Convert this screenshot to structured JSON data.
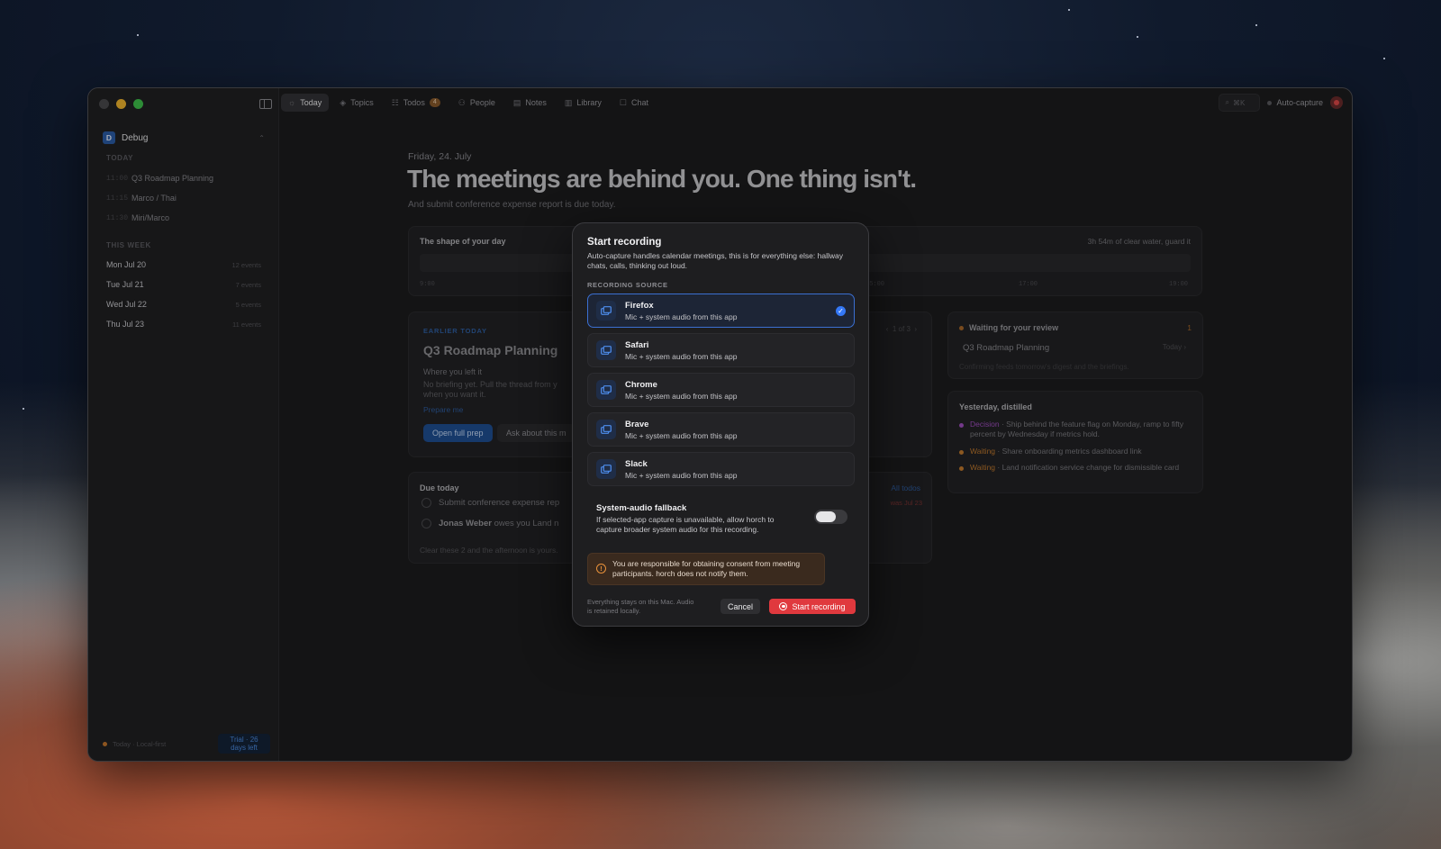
{
  "toolbar": {
    "tabs": [
      {
        "label": "Today",
        "icon": "sun-icon"
      },
      {
        "label": "Topics",
        "icon": "layers-icon"
      },
      {
        "label": "Todos",
        "icon": "checklist-icon",
        "count": "4"
      },
      {
        "label": "People",
        "icon": "people-icon"
      },
      {
        "label": "Notes",
        "icon": "notes-icon"
      },
      {
        "label": "Library",
        "icon": "library-icon"
      },
      {
        "label": "Chat",
        "icon": "chat-icon"
      }
    ],
    "search_shortcut": "⌘K",
    "auto_capture_label": "Auto-capture"
  },
  "sidebar": {
    "workspace": {
      "initial": "D",
      "name": "Debug"
    },
    "today_heading": "TODAY",
    "today_items": [
      {
        "time": "11:00",
        "label": "Q3 Roadmap Planning"
      },
      {
        "time": "11:15",
        "label": "Marco / Thai"
      },
      {
        "time": "11:30",
        "label": "Miri/Marco"
      }
    ],
    "week_heading": "THIS WEEK",
    "week_items": [
      {
        "label": "Mon Jul 20",
        "count": "12 events"
      },
      {
        "label": "Tue Jul 21",
        "count": "7 events"
      },
      {
        "label": "Wed Jul 22",
        "count": "5 events"
      },
      {
        "label": "Thu Jul 23",
        "count": "11 events"
      }
    ],
    "footer_status": "Today · Local-first",
    "trial": "Trial · 26 days left"
  },
  "main": {
    "date": "Friday, 24. July",
    "headline": "The meetings are behind you. One thing isn't.",
    "subline": "And submit conference expense report is due today.",
    "day_shape": {
      "title": "The shape of your day",
      "right": "3h 54m of clear water, guard it",
      "ticks": [
        "9:00",
        "15:00",
        "17:00",
        "19:00"
      ]
    },
    "earlier": {
      "eyebrow": "EARLIER TODAY",
      "title": "Q3 Roadmap Planning",
      "label": "Where you left it",
      "text": "No briefing yet. Pull the thread from y when you want it.",
      "link": "Prepare me",
      "primary_button": "Open full prep",
      "secondary_button": "Ask about this m",
      "pager": "1 of 3"
    },
    "due": {
      "title": "Due today",
      "all_link": "All todos",
      "rows": [
        {
          "prefix": "",
          "text": "Submit conference expense rep",
          "late": "was Jul 23"
        },
        {
          "prefix": "Jonas Weber",
          "text": " owes you Land n",
          "late": ""
        }
      ],
      "footer": "Clear these 2 and the afternoon is yours."
    },
    "review": {
      "title": "Waiting for your review",
      "count": "1",
      "item": "Q3 Roadmap Planning",
      "item_time": "Today",
      "footer": "Confirming feeds tomorrow's digest and the briefings."
    },
    "distilled": {
      "title": "Yesterday, distilled",
      "rows": [
        {
          "kind": "Decision",
          "color": "#a04fbf",
          "text": " · Ship behind the feature flag on Monday, ramp to fifty percent by Wednesday if metrics hold."
        },
        {
          "kind": "Waiting",
          "color": "#c27a2e",
          "text": " · Share onboarding metrics dashboard link"
        },
        {
          "kind": "Waiting",
          "color": "#c27a2e",
          "text": " · Land notification service change for dismissible card"
        }
      ]
    }
  },
  "modal": {
    "title": "Start recording",
    "description": "Auto-capture handles calendar meetings, this is for everything else: hallway chats, calls, thinking out loud.",
    "section_label": "RECORDING SOURCE",
    "sources": [
      {
        "name": "Firefox",
        "sub": "Mic + system audio from this app",
        "selected": true
      },
      {
        "name": "Safari",
        "sub": "Mic + system audio from this app",
        "selected": false
      },
      {
        "name": "Chrome",
        "sub": "Mic + system audio from this app",
        "selected": false
      },
      {
        "name": "Brave",
        "sub": "Mic + system audio from this app",
        "selected": false
      },
      {
        "name": "Slack",
        "sub": "Mic + system audio from this app",
        "selected": false
      }
    ],
    "fallback_title": "System-audio fallback",
    "fallback_desc": "If selected-app capture is unavailable, allow horch to capture broader system audio for this recording.",
    "fallback_enabled": false,
    "warning": "You are responsible for obtaining consent from meeting participants. horch does not notify them.",
    "footer_note": "Everything stays on this Mac. Audio is retained locally.",
    "cancel_label": "Cancel",
    "start_label": "Start recording"
  },
  "colors": {
    "accent": "#3478f6",
    "record": "#e0393e",
    "warning": "#e8913a"
  }
}
